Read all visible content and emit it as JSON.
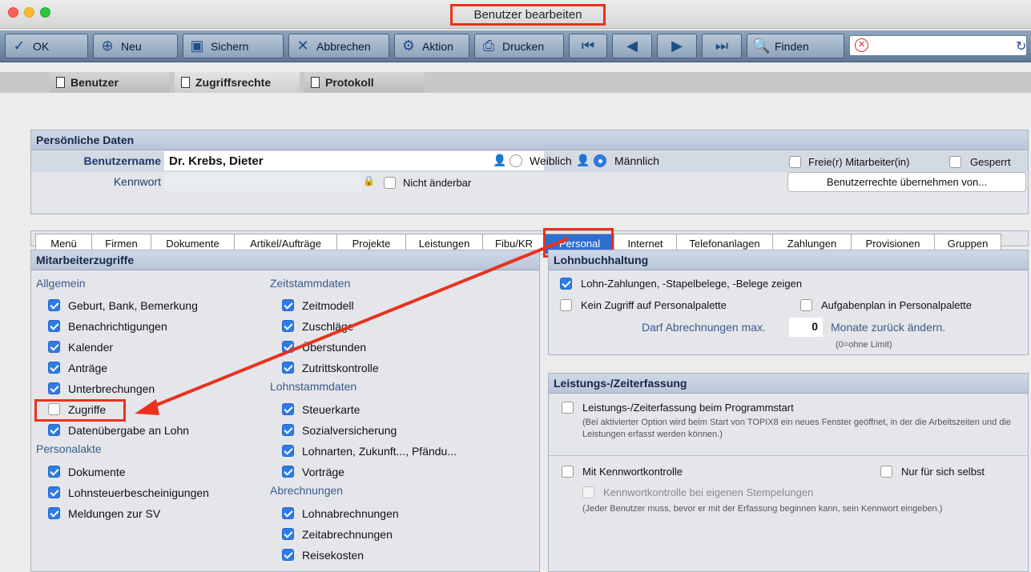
{
  "window": {
    "title": "Benutzer bearbeiten"
  },
  "toolbar": {
    "ok": "OK",
    "neu": "Neu",
    "sichern": "Sichern",
    "abbrechen": "Abbrechen",
    "aktion": "Aktion",
    "drucken": "Drucken",
    "finden": "Finden"
  },
  "tabs": {
    "benutzer": "Benutzer",
    "zugriffsrechte": "Zugriffsrechte",
    "protokoll": "Protokoll"
  },
  "personal_data": {
    "header": "Persönliche Daten",
    "username_label": "Benutzername",
    "username_value": "Dr. Krebs, Dieter",
    "password_label": "Kennwort",
    "not_changeable": "Nicht änderbar",
    "female": "Weiblich",
    "male": "Männlich",
    "freelancer": "Freie(r) Mitarbeiter(in)",
    "locked": "Gesperrt",
    "copy_rights_button": "Benutzerrechte übernehmen von..."
  },
  "subtabs": [
    "Menü",
    "Firmen",
    "Dokumente",
    "Artikel/Aufträge",
    "Projekte",
    "Leistungen",
    "Fibu/KR",
    "Personal",
    "Internet",
    "Telefonanlagen",
    "Zahlungen",
    "Provisionen",
    "Gruppen"
  ],
  "staff_access": {
    "header": "Mitarbeiterzugriffe",
    "general": "Allgemein",
    "general_items": [
      {
        "label": "Geburt, Bank, Bemerkung",
        "checked": true
      },
      {
        "label": "Benachrichtigungen",
        "checked": true
      },
      {
        "label": "Kalender",
        "checked": true
      },
      {
        "label": "Anträge",
        "checked": true
      },
      {
        "label": "Unterbrechungen",
        "checked": true
      },
      {
        "label": "Zugriffe",
        "checked": false
      },
      {
        "label": "Datenübergabe an Lohn",
        "checked": true
      }
    ],
    "file": "Personalakte",
    "file_items": [
      {
        "label": "Dokumente",
        "checked": true
      },
      {
        "label": "Lohnsteuerbescheinigungen",
        "checked": true
      },
      {
        "label": "Meldungen zur SV",
        "checked": true
      }
    ],
    "time_master": "Zeitstammdaten",
    "time_items": [
      {
        "label": "Zeitmodell",
        "checked": true
      },
      {
        "label": "Zuschläge",
        "checked": true
      },
      {
        "label": "Überstunden",
        "checked": true
      },
      {
        "label": "Zutrittskontrolle",
        "checked": true
      }
    ],
    "wage_master": "Lohnstammdaten",
    "wage_items": [
      {
        "label": "Steuerkarte",
        "checked": true
      },
      {
        "label": "Sozialversicherung",
        "checked": true
      },
      {
        "label": "Lohnarten, Zukunft..., Pfändu...",
        "checked": true
      },
      {
        "label": "Vorträge",
        "checked": true
      }
    ],
    "billing": "Abrechnungen",
    "billing_items": [
      {
        "label": "Lohnabrechnungen",
        "checked": true
      },
      {
        "label": "Zeitabrechnungen",
        "checked": true
      },
      {
        "label": "Reisekosten",
        "checked": true
      }
    ]
  },
  "payroll": {
    "header": "Lohnbuchhaltung",
    "show_payments": "Lohn-Zahlungen, -Stapelbelege, -Belege zeigen",
    "no_access_palette": "Kein Zugriff auf Personalpalette",
    "task_plan": "Aufgabenplan in Personalpalette",
    "max_label": "Darf Abrechnungen max.",
    "max_value": "0",
    "max_suffix": "Monate zurück ändern.",
    "no_limit": "(0=ohne Limit)"
  },
  "time_recording": {
    "header": "Leistungs-/Zeiterfassung",
    "on_start": "Leistungs-/Zeiterfassung beim Programmstart",
    "on_start_note": "(Bei aktivierter Option wird beim Start von TOPIX8 ein neues Fenster geöffnet, in der die Arbeitszeiten und die Leistungen erfasst werden können.)",
    "pw_control": "Mit Kennwortkontrolle",
    "self_only": "Nur für sich selbst",
    "pw_own_stamps": "Kennwortkontrolle bei eigenen Stempelungen",
    "pw_note": "(Jeder Benutzer muss, bevor er mit der Erfassung beginnen kann, sein Kennwort eingeben.)"
  },
  "colors": {
    "highlight": "#e8321e",
    "accent": "#2f7be6",
    "active_tab": "#2f6fd0"
  }
}
